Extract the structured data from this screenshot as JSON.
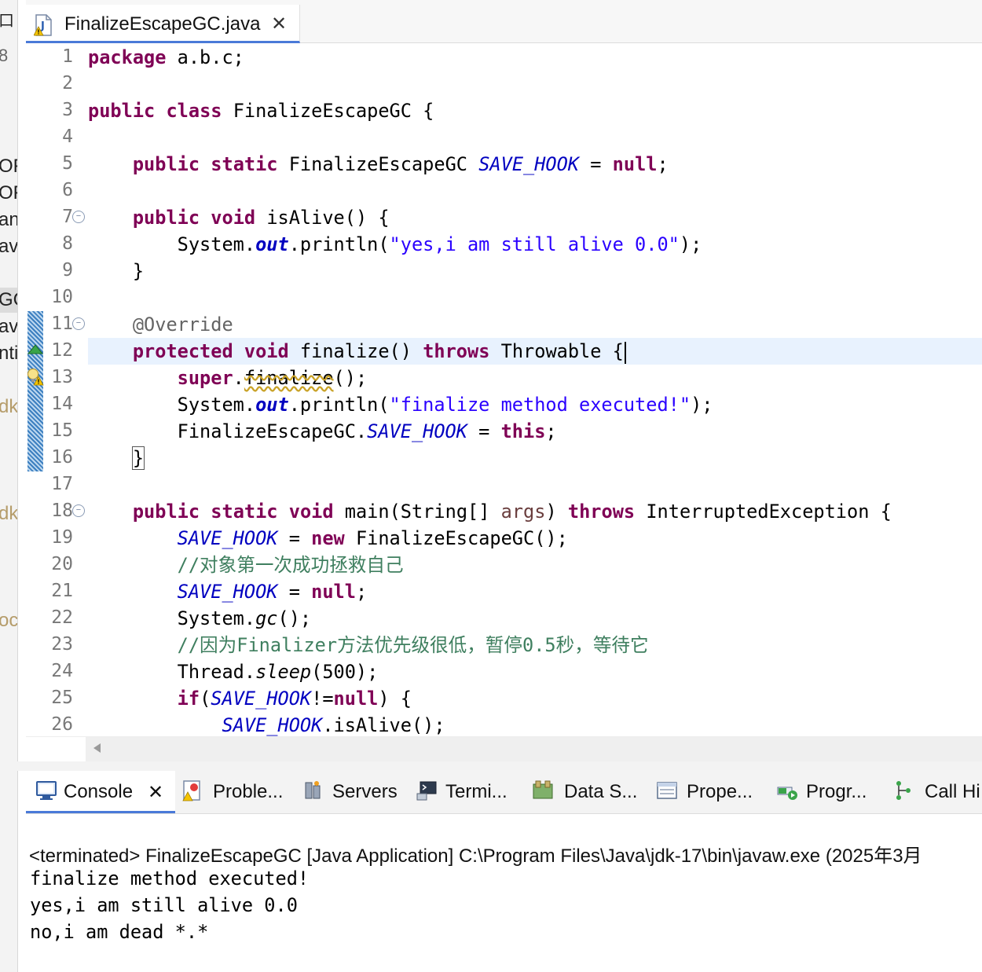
{
  "left_strip": {
    "fragments": [
      "口",
      "8",
      "OF",
      "OF",
      "ant",
      "av",
      "GC",
      "ava",
      "nti",
      "dk",
      "dk",
      "oc"
    ]
  },
  "editor_tab": {
    "filename": "FinalizeEscapeGC.java",
    "close_glyph": "✕"
  },
  "editor": {
    "line_numbers": [
      "1",
      "2",
      "3",
      "4",
      "5",
      "6",
      "7",
      "8",
      "9",
      "10",
      "11",
      "12",
      "13",
      "14",
      "15",
      "16",
      "17",
      "18",
      "19",
      "20",
      "21",
      "22",
      "23",
      "24",
      "25",
      "26"
    ],
    "tokens": {
      "package_kw": "package",
      "package_name": " a.b.c;",
      "public_kw": "public",
      "class_kw": "class",
      "class_name": " FinalizeEscapeGC {",
      "static_kw": "static",
      "type_name": " FinalizeEscapeGC ",
      "save_hook": "SAVE_HOOK",
      "assign": " = ",
      "null_kw": "null",
      "semicolon": ";",
      "void_kw": "void",
      "is_alive_decl": " isAlive() {",
      "system": "System.",
      "out": "out",
      "println_open": ".println(",
      "alive_str": "\"yes,i am still alive 0.0\"",
      "close_paren_semi": ");",
      "close_brace": "}",
      "override": "@Override",
      "protected_kw": "protected",
      "finalize_decl": " finalize() ",
      "throws_kw": "throws",
      "throwable": " Throwable {",
      "super_kw": "super",
      "dot": ".",
      "finalize_name": "finalize",
      "call_semi": "();",
      "finalize_str": "\"finalize method executed!\"",
      "class_ref": "FinalizeEscapeGC.",
      "this_kw": "this",
      "main_decl": " main(String[] ",
      "args": "args",
      "main_rest": ") ",
      "interrupted": " InterruptedException {",
      "new_kw": "new",
      "new_obj": " FinalizeEscapeGC();",
      "comment1": "//对象第一次成功拯救自己",
      "gc_pre": "System.",
      "gc": "gc",
      "gc_post": "();",
      "comment2": "//因为Finalizer方法优先级很低，暂停0.5秒，等待它",
      "thread": "Thread.",
      "sleep": "sleep",
      "sleep_arg": "(500);",
      "if_kw": "if",
      "open_paren": "(",
      "neq": "!=",
      "if_close": ") {",
      "is_alive_call": ".isAlive();"
    }
  },
  "panel_tabs": [
    {
      "label": "Console",
      "icon": "console-icon"
    },
    {
      "label": "Proble...",
      "icon": "problems-icon"
    },
    {
      "label": "Servers",
      "icon": "servers-icon"
    },
    {
      "label": "Termi...",
      "icon": "terminal-icon"
    },
    {
      "label": "Data S...",
      "icon": "data-source-icon"
    },
    {
      "label": "Prope...",
      "icon": "properties-icon"
    },
    {
      "label": "Progr...",
      "icon": "progress-icon"
    },
    {
      "label": "Call Hi",
      "icon": "call-hierarchy-icon"
    }
  ],
  "console": {
    "close_glyph": "✕",
    "header": "<terminated> FinalizeEscapeGC [Java Application] C:\\Program Files\\Java\\jdk-17\\bin\\javaw.exe  (2025年3月",
    "output": [
      "finalize method executed!",
      "yes,i am still alive 0.0",
      "no,i am dead *.*"
    ]
  },
  "colors": {
    "keyword": "#7f0055",
    "field": "#0000c0",
    "string": "#2a00ff",
    "comment": "#3f7f5f",
    "annotation": "#646464",
    "current_line": "#e8f2fe",
    "active_tab_underline": "#4a7ad8"
  }
}
